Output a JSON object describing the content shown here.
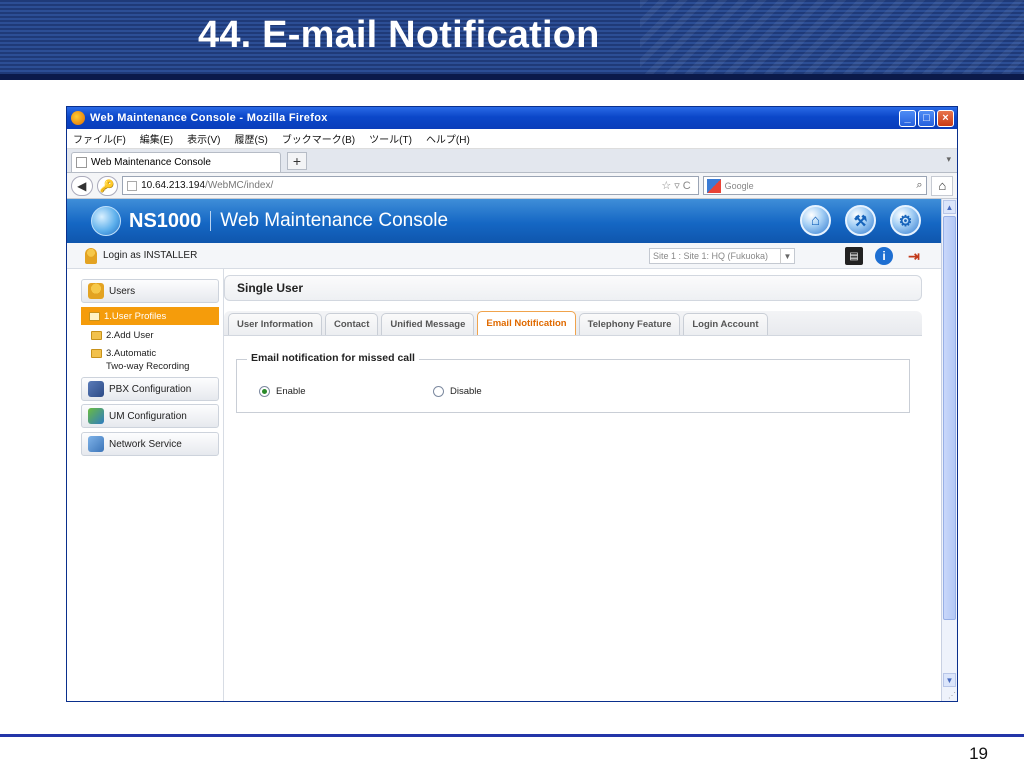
{
  "slide": {
    "title": "44. E-mail Notification",
    "page_number": "19"
  },
  "browser": {
    "window_title": "Web Maintenance Console - Mozilla Firefox",
    "menu": [
      "ファイル(F)",
      "編集(E)",
      "表示(V)",
      "履歴(S)",
      "ブックマーク(B)",
      "ツール(T)",
      "ヘルプ(H)"
    ],
    "tab_title": "Web Maintenance Console",
    "url_domain": "10.64.213.194",
    "url_path": "/WebMC/index/",
    "search_placeholder": "Google"
  },
  "app": {
    "brand": "NS1000",
    "name": "Web Maintenance Console",
    "login": "Login as INSTALLER",
    "site_select": "Site 1 : Site 1: HQ (Fukuoka)"
  },
  "sidebar": {
    "sections": [
      {
        "label": "Users"
      },
      {
        "label": "PBX Configuration"
      },
      {
        "label": "UM Configuration"
      },
      {
        "label": "Network Service"
      }
    ],
    "user_items": [
      {
        "label": "1.User Profiles"
      },
      {
        "label": "2.Add User"
      },
      {
        "label": "3.Automatic",
        "label2": "Two-way Recording"
      }
    ]
  },
  "main": {
    "header": "Single User",
    "tabs": [
      "User Information",
      "Contact",
      "Unified Message",
      "Email Notification",
      "Telephony Feature",
      "Login Account"
    ],
    "active_tab": "Email Notification",
    "fieldset_legend": "Email notification for missed call",
    "options": [
      "Enable",
      "Disable"
    ],
    "selected_option": "Enable"
  }
}
